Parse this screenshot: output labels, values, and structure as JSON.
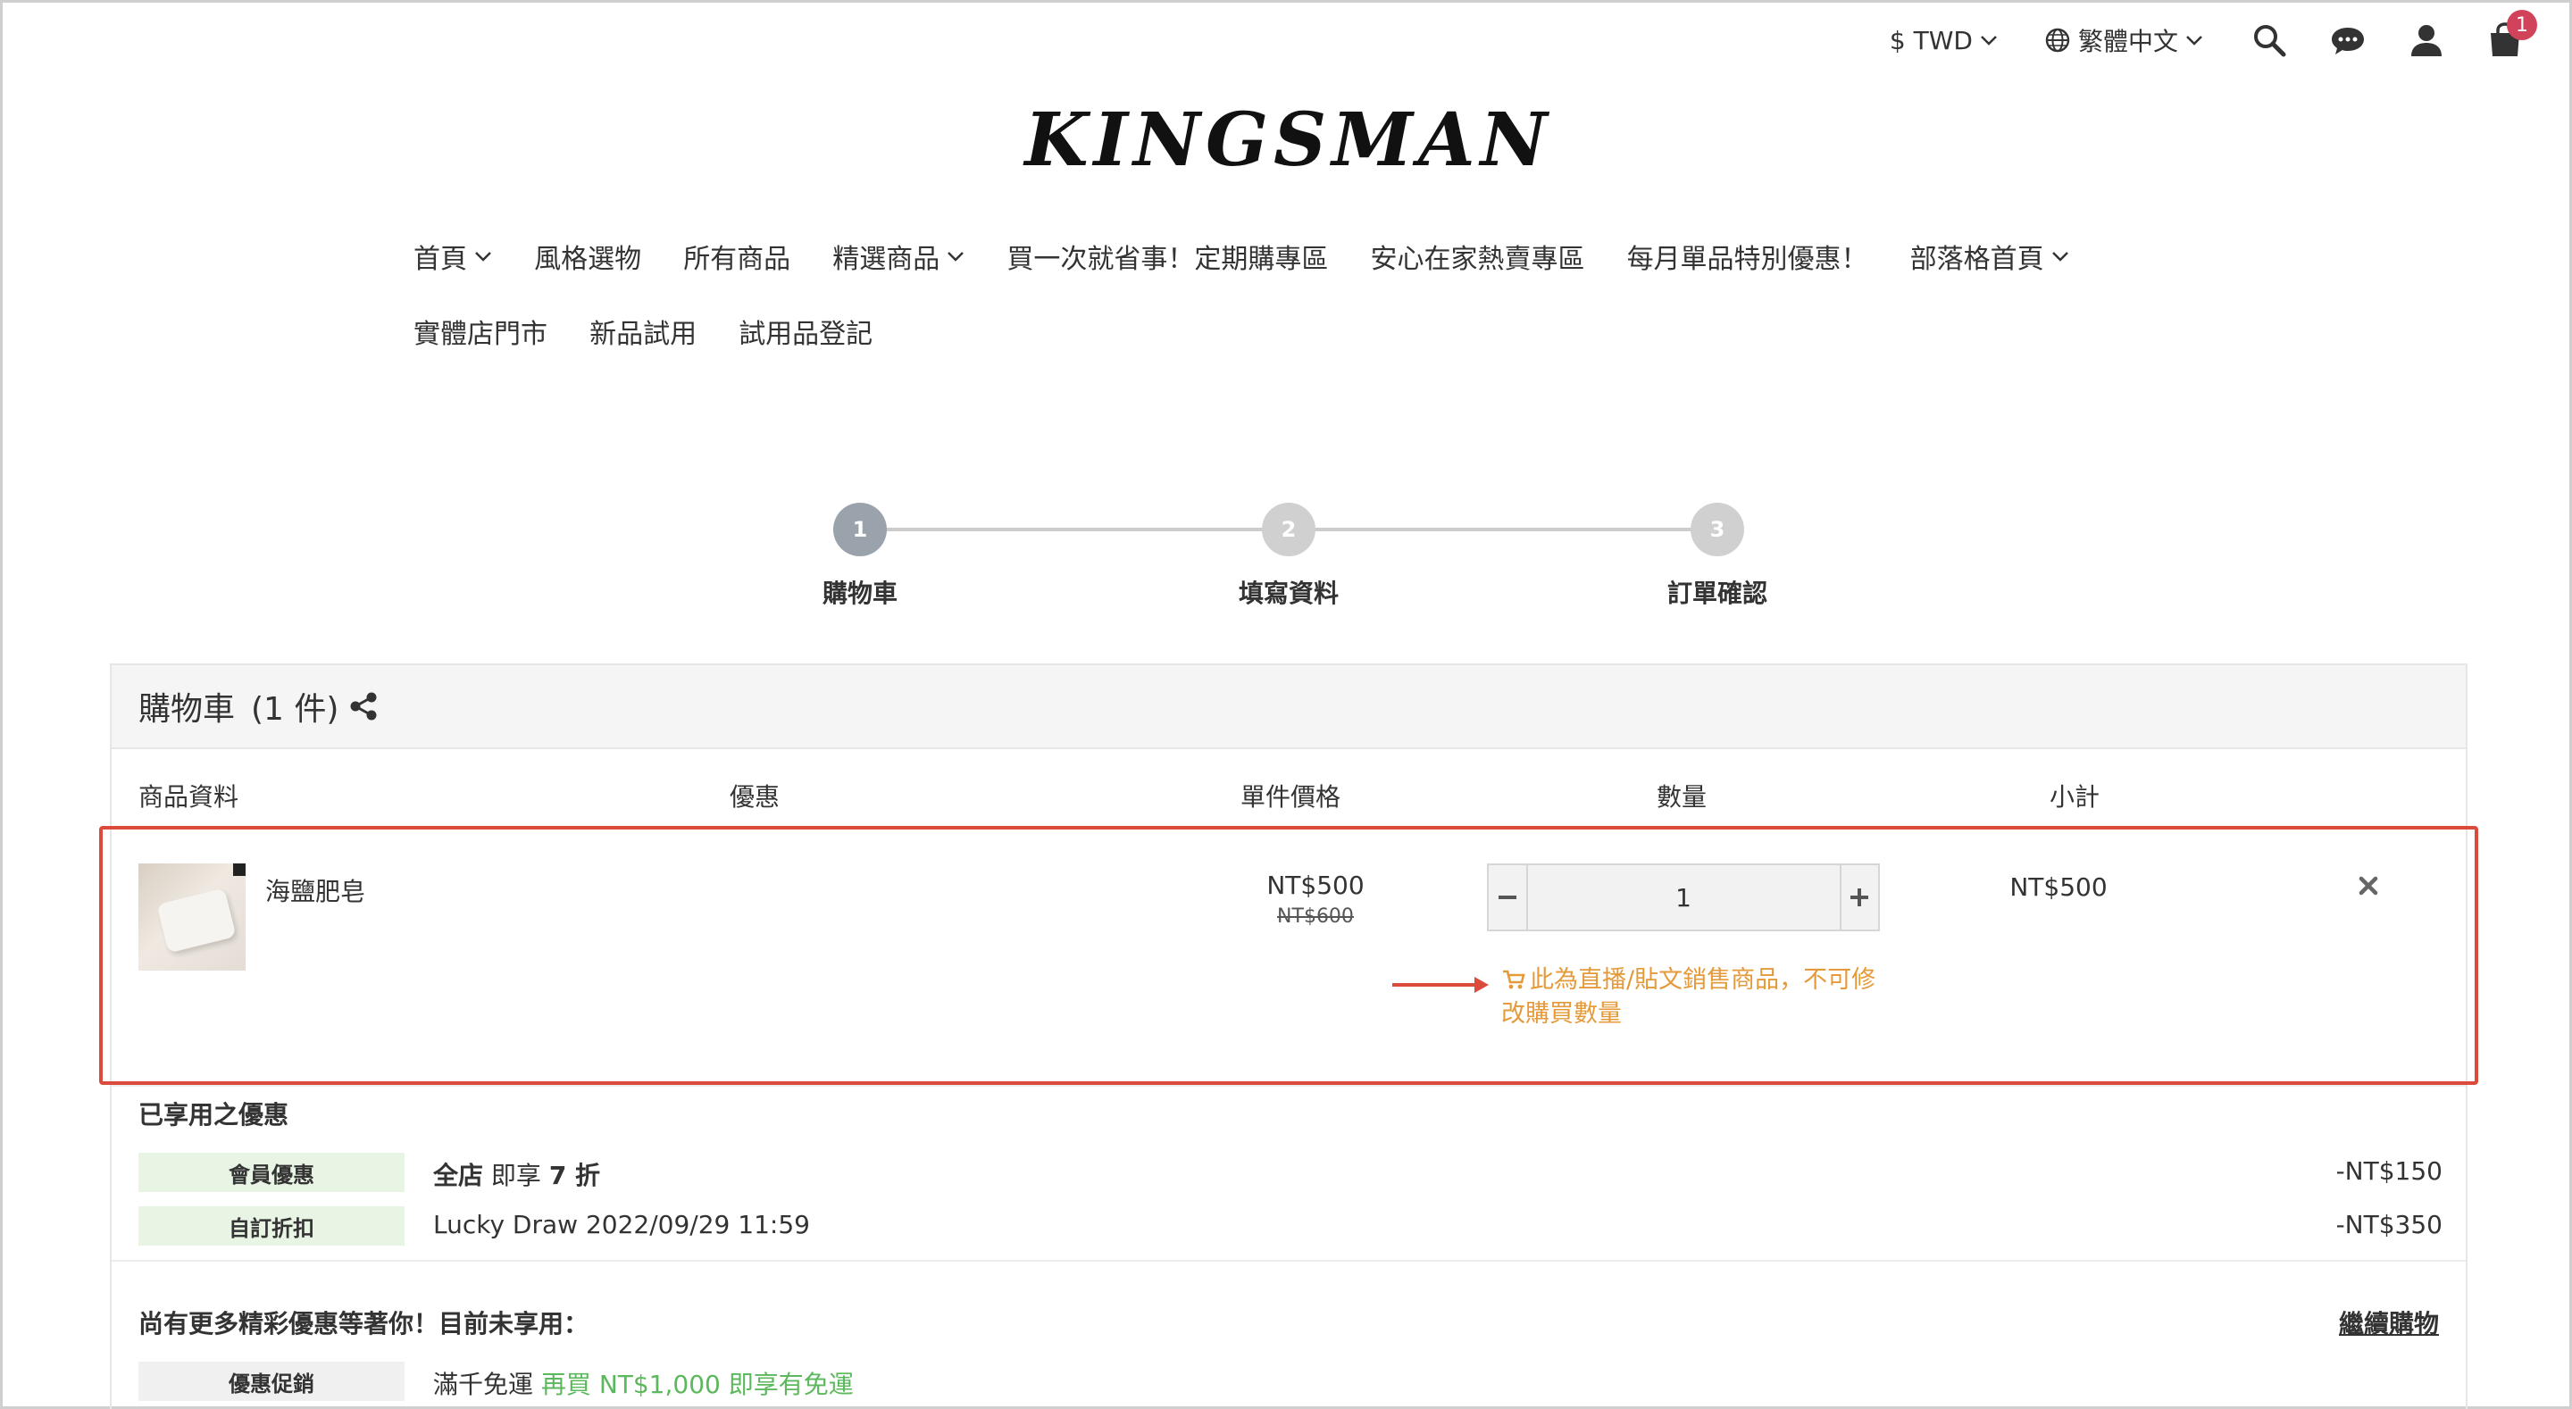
{
  "topbar": {
    "currency": "$ TWD",
    "language": "繁體中文",
    "cart_count": "1"
  },
  "logo": "KINGSMAN",
  "nav": {
    "row1": [
      "首頁",
      "風格選物",
      "所有商品",
      "精選商品",
      "買一次就省事！定期購專區",
      "安心在家熱賣專區",
      "每月單品特別優惠！",
      "部落格首頁"
    ],
    "row2": [
      "實體店門市",
      "新品試用",
      "試用品登記"
    ]
  },
  "steps": [
    {
      "num": "1",
      "label": "購物車"
    },
    {
      "num": "2",
      "label": "填寫資料"
    },
    {
      "num": "3",
      "label": "訂單確認"
    }
  ],
  "cart": {
    "title": "購物車",
    "count_label": "(1 件)",
    "columns": {
      "product": "商品資料",
      "discount": "優惠",
      "unit_price": "單件價格",
      "quantity": "數量",
      "subtotal": "小計"
    },
    "item": {
      "name": "海鹽肥皂",
      "price": "NT$500",
      "original_price": "NT$600",
      "quantity": "1",
      "subtotal": "NT$500",
      "notice": "此為直播/貼文銷售商品，不可修改購買數量"
    },
    "applied": {
      "title": "已享用之優惠",
      "rows": [
        {
          "tag": "會員優惠",
          "text_bold1": "全店",
          "text_mid": " 即享 ",
          "text_bold2": "7 折",
          "amount": "-NT$150"
        },
        {
          "tag": "自訂折扣",
          "text": "Lucky Draw 2022/09/29 11:59",
          "amount": "-NT$350"
        }
      ]
    },
    "more": {
      "title": "尚有更多精彩優惠等著你！目前未享用：",
      "continue": "繼續購物",
      "promo_tag": "優惠促銷",
      "promo_text": "滿千免運",
      "promo_highlight": "再買 NT$1,000 即享有免運"
    }
  },
  "colors": {
    "badge": "#d1435b",
    "notice": "#e59a3a",
    "annotation": "#dc4a3c",
    "promo_green": "#5cb85c",
    "member_tag_bg": "#e8f4e4"
  }
}
